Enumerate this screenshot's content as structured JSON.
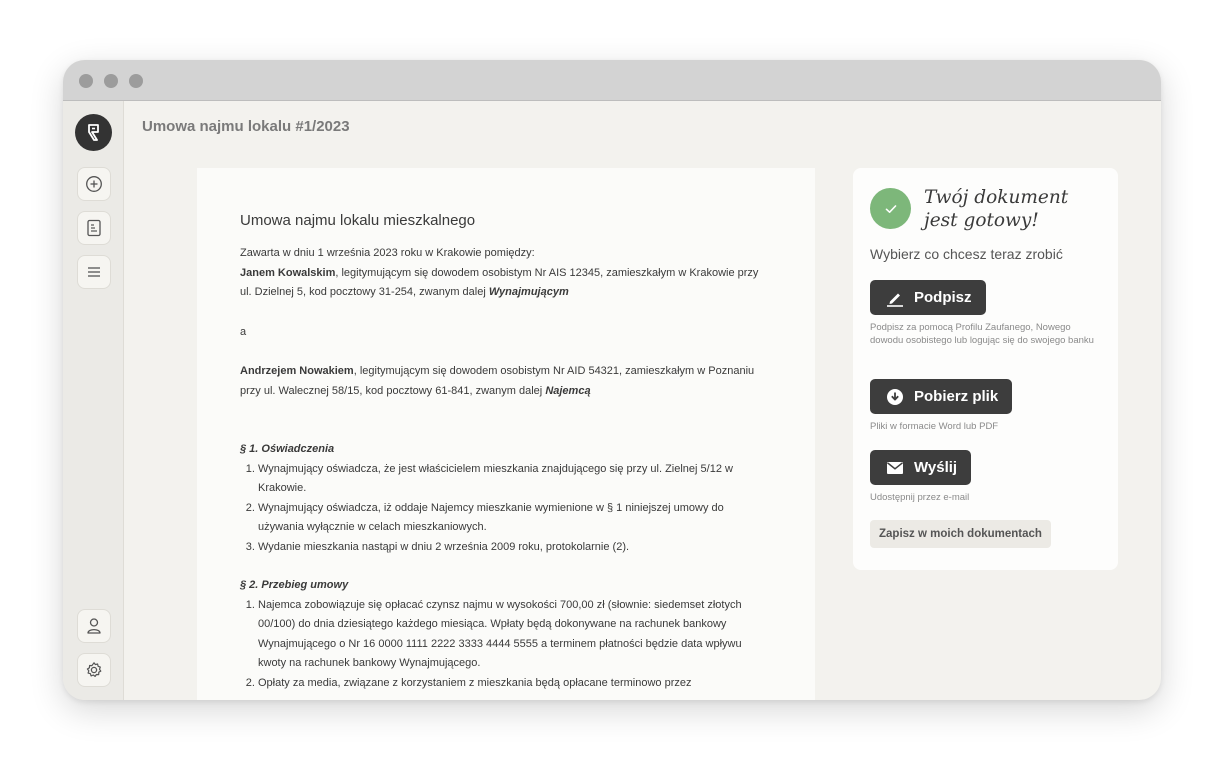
{
  "app": {
    "page_title": "Umowa najmu lokalu #1/2023"
  },
  "sidebar": {
    "items": [
      {
        "name": "new-document",
        "icon": "plus-circle-icon"
      },
      {
        "name": "documents",
        "icon": "document-icon"
      },
      {
        "name": "list",
        "icon": "menu-lines-icon"
      }
    ],
    "bottom": [
      {
        "name": "profile",
        "icon": "user-icon"
      },
      {
        "name": "settings",
        "icon": "gear-icon"
      }
    ]
  },
  "document": {
    "title": "Umowa najmu lokalu mieszkalnego",
    "intro": "Zawarta w dniu 1 września 2023 roku w Krakowie pomiędzy:",
    "party1_name": "Janem Kowalskim",
    "party1_text": ", legitymującym się dowodem osobistym Nr AIS 12345, zamieszkałym w Krakowie przy ul. Dzielnej 5, kod pocztowy 31-254, zwanym dalej ",
    "party1_role": "Wynajmującym",
    "and": "a",
    "party2_name": "Andrzejem Nowakiem",
    "party2_text": ", legitymującym się dowodem osobistym Nr AID 54321, zamieszkałym w Poznaniu przy ul. Walecznej 58/15, kod pocztowy 61-841, zwanym dalej ",
    "party2_role": "Najemcą",
    "section1_title": "§ 1. Oświadczenia",
    "section1_items": [
      "Wynajmujący oświadcza, że jest właścicielem mieszkania znajdującego się przy ul. Zielnej 5/12 w Krakowie.",
      "Wynajmujący oświadcza, iż oddaje Najemcy mieszkanie wymienione w § 1 niniejszej umowy do używania wyłącznie w celach mieszkaniowych.",
      "Wydanie mieszkania nastąpi w dniu 2 września 2009 roku, protokolarnie (2)."
    ],
    "section2_title": "§ 2. Przebieg umowy",
    "section2_items": [
      "Najemca zobowiązuje się opłacać czynsz najmu w wysokości 700,00 zł (słownie: siedemset złotych 00/100) do dnia dziesiątego każdego miesiąca. Wpłaty będą dokonywane na rachunek bankowy Wynajmującego o Nr 16 0000 1111 2222 3333 4444 5555 a terminem płatności będzie data wpływu kwoty na rachunek bankowy Wynajmującego.",
      "Opłaty za media, związane z korzystaniem z mieszkania będą opłacane terminowo przez"
    ]
  },
  "panel": {
    "ready_title": "Twój dokument jest gotowy!",
    "choose_text": "Wybierz co chcesz teraz zrobić",
    "sign_label": "Podpisz",
    "sign_desc": "Podpisz za pomocą Profilu Zaufanego, Nowego dowodu osobistego lub logując się do swojego banku",
    "download_label": "Pobierz plik",
    "download_desc": "Pliki w formacie Word lub PDF",
    "send_label": "Wyślij",
    "send_desc": "Udostępnij przez e-mail",
    "save_label": "Zapisz w moich dokumentach"
  },
  "colors": {
    "success": "#7db77a",
    "button_dark": "#3d3d3d",
    "background": "#f3f2ee"
  }
}
